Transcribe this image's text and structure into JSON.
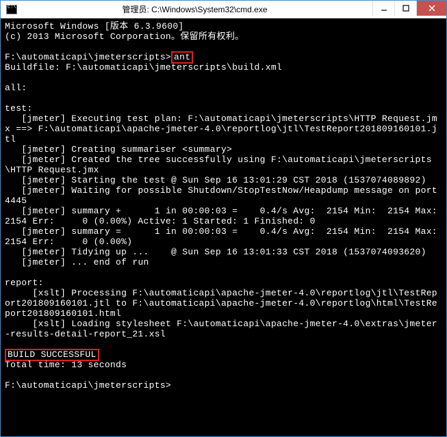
{
  "window": {
    "icon_label": "C:\\",
    "title": "管理员: C:\\Windows\\System32\\cmd.exe"
  },
  "terminal": {
    "line1": "Microsoft Windows [版本 6.3.9600]",
    "line2": "(c) 2013 Microsoft Corporation。保留所有权利。",
    "prompt1": "F:\\automaticapi\\jmeterscripts>",
    "cmd1": "ant",
    "line3": "Buildfile: F:\\automaticapi\\jmeterscripts\\build.xml",
    "line4": "all:",
    "line5": "test:",
    "line6": "   [jmeter] Executing test plan: F:\\automaticapi\\jmeterscripts\\HTTP Request.jmx ==> F:\\automaticapi\\apache-jmeter-4.0\\reportlog\\jtl\\TestReport201809160101.jtl",
    "line7": "   [jmeter] Creating summariser <summary>",
    "line8": "   [jmeter] Created the tree successfully using F:\\automaticapi\\jmeterscripts\\HTTP Request.jmx",
    "line9": "   [jmeter] Starting the test @ Sun Sep 16 13:01:29 CST 2018 (1537074089892)",
    "line10": "   [jmeter] Waiting for possible Shutdown/StopTestNow/Heapdump message on port 4445",
    "line11": "   [jmeter] summary +      1 in 00:00:03 =    0.4/s Avg:  2154 Min:  2154 Max:  2154 Err:     0 (0.00%) Active: 1 Started: 1 Finished: 0",
    "line12": "   [jmeter] summary =      1 in 00:00:03 =    0.4/s Avg:  2154 Min:  2154 Max:  2154 Err:     0 (0.00%)",
    "line13": "   [jmeter] Tidying up ...    @ Sun Sep 16 13:01:33 CST 2018 (1537074093620)",
    "line14": "   [jmeter] ... end of run",
    "line15": "report:",
    "line16": "     [xslt] Processing F:\\automaticapi\\apache-jmeter-4.0\\reportlog\\jtl\\TestReport201809160101.jtl to F:\\automaticapi\\apache-jmeter-4.0\\reportlog\\html\\TestReport201809160101.html",
    "line17": "     [xslt] Loading stylesheet F:\\automaticapi\\apache-jmeter-4.0\\extras\\jmeter-results-detail-report_21.xsl",
    "build_success": "BUILD SUCCESSFUL",
    "line18": "Total time: 13 seconds",
    "prompt2": "F:\\automaticapi\\jmeterscripts>"
  }
}
